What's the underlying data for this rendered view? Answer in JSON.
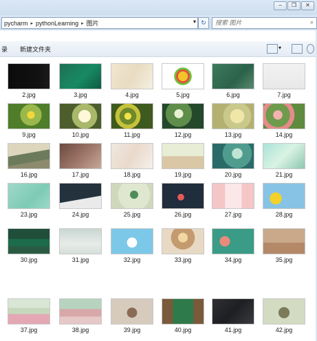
{
  "window": {
    "buttons": [
      "–",
      "❐",
      "✕"
    ],
    "address": {
      "crumbs": [
        "pycharm",
        "pythonLearning",
        "图片"
      ]
    },
    "search_placeholder": "搜索 图片"
  },
  "toolbar": {
    "left_label": "录",
    "new_folder_label": "新建文件夹"
  },
  "files": [
    {
      "name": "2.jpg",
      "bg": "linear-gradient(90deg,#0c0c0c 0%,#111 70%,#1a1a1a 100%)"
    },
    {
      "name": "3.jpg",
      "bg": "linear-gradient(135deg,#1f6f55,#178a62 55%,#0f5a44)"
    },
    {
      "name": "4.jpg",
      "bg": "linear-gradient(120deg,#f1e6cf,#e8dcc2 50%,#f5efe0)"
    },
    {
      "name": "5.jpg",
      "bg": "radial-gradient(circle at 50% 50%,#f2c32b 0 20%,#e34f3a 21% 28%,#6fc03b 29% 36%,#fff 37%)"
    },
    {
      "name": "6.jpg",
      "bg": "linear-gradient(135deg,#3d7a5c,#2b6249 60%,#5a8a70)"
    },
    {
      "name": "7.jpg",
      "bg": "linear-gradient(#f2f2f2,#e8e8e8)"
    },
    {
      "name": "9.jpg",
      "bg": "radial-gradient(circle at 55% 45%,#f1d83a 0 14%,#9ab84b 15% 40%,#4f7d2a 41%)"
    },
    {
      "name": "10.jpg",
      "bg": "radial-gradient(circle at 60% 50%,#fff8d8 0 22%,#a9b86b 23% 45%,#4c5e2c 46%)"
    },
    {
      "name": "11.jpg",
      "bg": "radial-gradient(circle at 40% 50%,#f4e24a 0 12%,#6d8a2a 13% 30%,#c7c23c 31% 45%,#3f5a1e 46%)"
    },
    {
      "name": "12.jpg",
      "bg": "radial-gradient(circle at 40% 40%,#e8f0d2 0 15%,#5f8d4a 16% 45%,#24482b 46%)"
    },
    {
      "name": "13.jpg",
      "bg": "radial-gradient(circle at 60% 50%,#f0e6a8 0 25%,#c8c98a 26% 50%,#b4b070 51%)"
    },
    {
      "name": "14.jpg",
      "bg": "radial-gradient(circle at 35% 45%,#f3b3b0 0 15%,#6f9b4c 16% 40%,#e58b8b 41% 55%,#5e8b3e 56%)"
    },
    {
      "name": "16.jpg",
      "bg": "linear-gradient(170deg,#ddd6bd 0 40%,#6c7b5c 41% 70%,#8d8b6d 71%)"
    },
    {
      "name": "17.jpg",
      "bg": "linear-gradient(135deg,#6b4a3f,#9b7466 50%,#c7a899)"
    },
    {
      "name": "18.jpg",
      "bg": "linear-gradient(120deg,#f0e8df,#e9d9cc 50%,#f6f0ea)"
    },
    {
      "name": "19.jpg",
      "bg": "linear-gradient(#e8eed6 0 50%,#d9c7a6 51%)"
    },
    {
      "name": "20.jpg",
      "bg": "radial-gradient(circle at 60% 40%,#bfe4d4 0 18%,#4f9c8f 19% 50%,#2a6b6a 51%)"
    },
    {
      "name": "21.jpg",
      "bg": "linear-gradient(135deg,#a9e3d9,#d9f3e3 50%,#8fc6b3)"
    },
    {
      "name": "23.jpg",
      "bg": "linear-gradient(135deg,#9fd8c9,#7ecbb5 60%,#9ad9c8)"
    },
    {
      "name": "24.jpg",
      "bg": "linear-gradient(170deg,#24323d 0 60%,#eaeaea 61%)"
    },
    {
      "name": "25.jpg",
      "bg": "radial-gradient(circle at 55% 45%,#4f8c5a 0 15%,#dfe7cf 16% 60%,#cfd8bd 61%)"
    },
    {
      "name": "26.jpg",
      "bg": "radial-gradient(circle at 45% 55%,#e35a5a 0 12%,#1f2d3c 13%)"
    },
    {
      "name": "27.jpg",
      "bg": "linear-gradient(90deg,#f4c6c6 0 30%,#fbe7e7 31% 70%,#f4c6c6 71%)"
    },
    {
      "name": "28.jpg",
      "bg": "radial-gradient(circle at 30% 60%,#f2d12a 0 18%,#86c3e4 19%)"
    },
    {
      "name": "30.jpg",
      "bg": "linear-gradient(#1f4e3a 0 40%,#1c6b4a 41% 70%,#2b5a43 71%)"
    },
    {
      "name": "31.jpg",
      "bg": "linear-gradient(#c9d6d2,#e7ece8 60%,#d6dfda)"
    },
    {
      "name": "32.jpg",
      "bg": "radial-gradient(circle at 50% 55%,#ffffff 0 20%,#7cc8e8 21%)"
    },
    {
      "name": "33.jpg",
      "bg": "radial-gradient(circle at 50% 35%,#f3d7a3 0 18%,#c49b6e 19% 45%,#e8d9c4 46%)"
    },
    {
      "name": "34.jpg",
      "bg": "radial-gradient(circle at 30% 50%,#e98b7a 0 16%,#3a9b86 17%)"
    },
    {
      "name": "35.jpg",
      "bg": "linear-gradient(#c9a98a 0 55%,#b38968 56%)"
    },
    {
      "name": "37.jpg",
      "bg": "linear-gradient(#d9e6d6 0 35%,#c6d8bc 36% 60%,#e4a8b5 61%)"
    },
    {
      "name": "38.jpg",
      "bg": "linear-gradient(#b7d4c0 0 40%,#d8a8a8 41% 70%,#e7c8c8 71%)"
    },
    {
      "name": "39.jpg",
      "bg": "radial-gradient(circle at 50% 55%,#8b6b55 0 20%,#d6cbbd 21%)"
    },
    {
      "name": "40.jpg",
      "bg": "linear-gradient(90deg,#7a5a3a 0 25%,#2f7a4a 26% 75%,#7a5a3a 76%)"
    },
    {
      "name": "41.jpg",
      "bg": "linear-gradient(135deg,#2f3033,#1e1f22 50%,#3a3b3e)"
    },
    {
      "name": "42.jpg",
      "bg": "radial-gradient(circle at 50% 55%,#7b7b5a 0 22%,#d3dbc2 23%)"
    }
  ]
}
